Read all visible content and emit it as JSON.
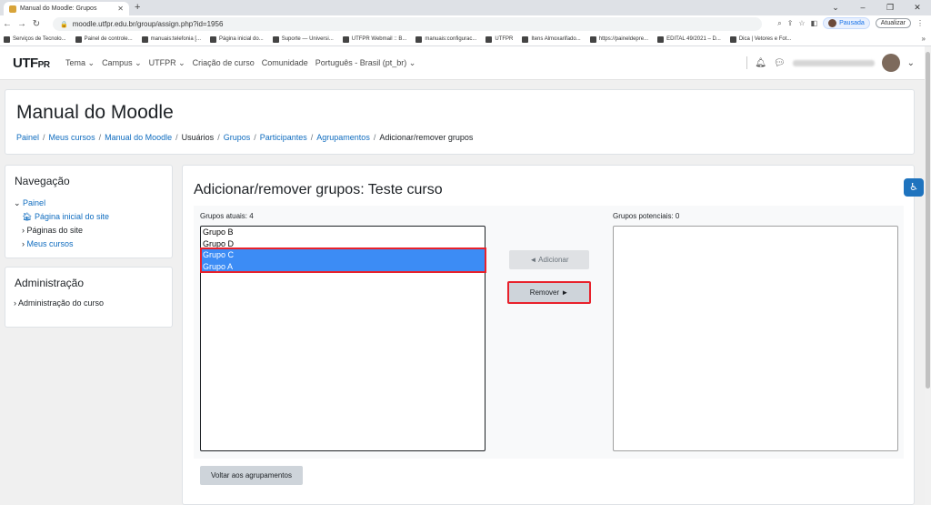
{
  "browser": {
    "tab_title": "Manual do Moodle: Grupos",
    "tab_close": "✕",
    "new_tab": "+",
    "url": "moodle.utfpr.edu.br/group/assign.php?id=1956",
    "profile_status": "Pausada",
    "update_label": "Atualizar",
    "window_controls": [
      "⌄",
      "–",
      "❐",
      "✕"
    ],
    "bookmarks": [
      "Serviços de Tecnolo...",
      "Painel de controle...",
      "manuais:telefonia [...",
      "Página inicial do...",
      "Suporte — Universi...",
      "UTFPR Webmail :: B...",
      "manuais:configurac...",
      "UTFPR",
      "Itens Almoxarifado...",
      "https://paineldepre...",
      "EDITAL 49/2021 – D...",
      "Dica | Vetores e Fot..."
    ],
    "bookmarks_more": "»"
  },
  "navbar": {
    "logo_main": "UTF",
    "logo_suffix": "PR",
    "menu": [
      "Tema ⌄",
      "Campus ⌄",
      "UTFPR ⌄",
      "Criação de curso",
      "Comunidade",
      "Português - Brasil (pt_br) ⌄"
    ],
    "bell_icon": "🔔",
    "chat_icon": "💬",
    "user_caret": "⌄"
  },
  "header": {
    "title": "Manual do Moodle",
    "breadcrumb": [
      {
        "label": "Painel",
        "link": true
      },
      {
        "label": "Meus cursos",
        "link": true
      },
      {
        "label": "Manual do Moodle",
        "link": true
      },
      {
        "label": "Usuários",
        "link": false
      },
      {
        "label": "Grupos",
        "link": true
      },
      {
        "label": "Participantes",
        "link": true
      },
      {
        "label": "Agrupamentos",
        "link": true
      },
      {
        "label": "Adicionar/remover grupos",
        "link": false
      }
    ]
  },
  "navigation_block": {
    "title": "Navegação",
    "root": "Painel",
    "items": [
      {
        "label": "Página inicial do site",
        "prefix": "🏠"
      },
      {
        "label": "Páginas do site",
        "prefix": "›"
      },
      {
        "label": "Meus cursos",
        "prefix": "›"
      }
    ]
  },
  "admin_block": {
    "title": "Administração",
    "item": "Administração do curso"
  },
  "main": {
    "title": "Adicionar/remover grupos: Teste curso",
    "current_label": "Grupos atuais: 4",
    "potential_label": "Grupos potenciais: 0",
    "current_groups": [
      {
        "name": "Grupo B",
        "selected": false
      },
      {
        "name": "Grupo D",
        "selected": false
      },
      {
        "name": "Grupo C",
        "selected": true
      },
      {
        "name": "Grupo A",
        "selected": true
      }
    ],
    "add_button": "◄ Adicionar",
    "remove_button": "Remover ►",
    "back_button": "Voltar aos agrupamentos"
  },
  "colors": {
    "link": "#0f6cbf",
    "selection": "#3c8cf5",
    "highlight": "#e8212b"
  }
}
